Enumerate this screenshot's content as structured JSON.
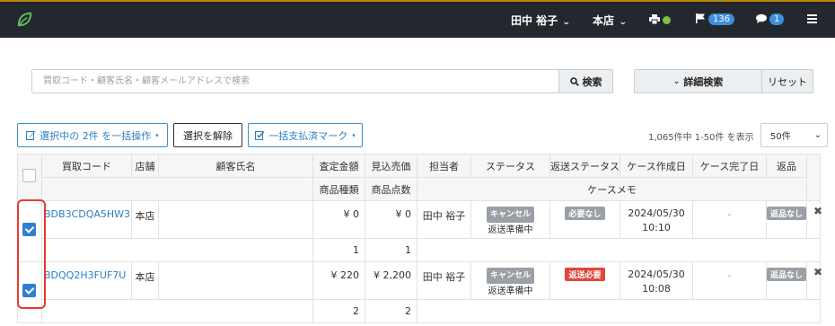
{
  "navbar": {
    "user": "田中 裕子",
    "store": "本店",
    "flag_count": "136",
    "comment_count": "1"
  },
  "search": {
    "placeholder": "買取コード・顧客氏名・顧客メールアドレスで検索",
    "button_label": "検索",
    "advanced_label": "詳細検索",
    "reset_label": "リセット"
  },
  "toolbar": {
    "bulk_action_label": "選択中の 2件 を一括操作",
    "deselect_label": "選択を解除",
    "bulk_paid_label": "一括支払済マーク",
    "count_text": "1,065件中 1-50件 を表示",
    "per_page": "50件"
  },
  "table": {
    "headers": {
      "code": "買取コード",
      "store": "店舗",
      "customer": "顧客氏名",
      "appraisal": "査定金額",
      "expected": "見込売価",
      "staff": "担当者",
      "status": "ステータス",
      "return_status": "返送ステータス",
      "created": "ケース作成日",
      "completed": "ケース完了日",
      "returned": "返品",
      "item_types": "商品種類",
      "item_count": "商品点数",
      "case_memo": "ケースメモ"
    },
    "rows": [
      {
        "code": "BDB3CDQA5HW3",
        "store": "本店",
        "customer": "",
        "appraisal": "¥ 0",
        "expected": "¥ 0",
        "staff": "田中 裕子",
        "status_badge": "キャンセル",
        "status_sub": "返送準備中",
        "return_status": "必要なし",
        "created_date": "2024/05/30",
        "created_time": "10:10",
        "completed": "-",
        "returned": "返品なし",
        "item_types": "1",
        "item_count": "1"
      },
      {
        "code": "BDQQ2H3FUF7U",
        "store": "本店",
        "customer": "",
        "appraisal": "¥ 220",
        "expected": "¥ 2,200",
        "staff": "田中 裕子",
        "status_badge": "キャンセル",
        "status_sub": "返送準備中",
        "return_status": "返送必要",
        "created_date": "2024/05/30",
        "created_time": "10:08",
        "completed": "-",
        "returned": "返品なし",
        "item_types": "2",
        "item_count": "2"
      }
    ]
  },
  "colors": {
    "navbar_bg": "#23272e",
    "primary": "#2e7fc0",
    "badge_gray": "#9aa0a6",
    "badge_red": "#e0463c",
    "highlight_box": "#e53935"
  }
}
